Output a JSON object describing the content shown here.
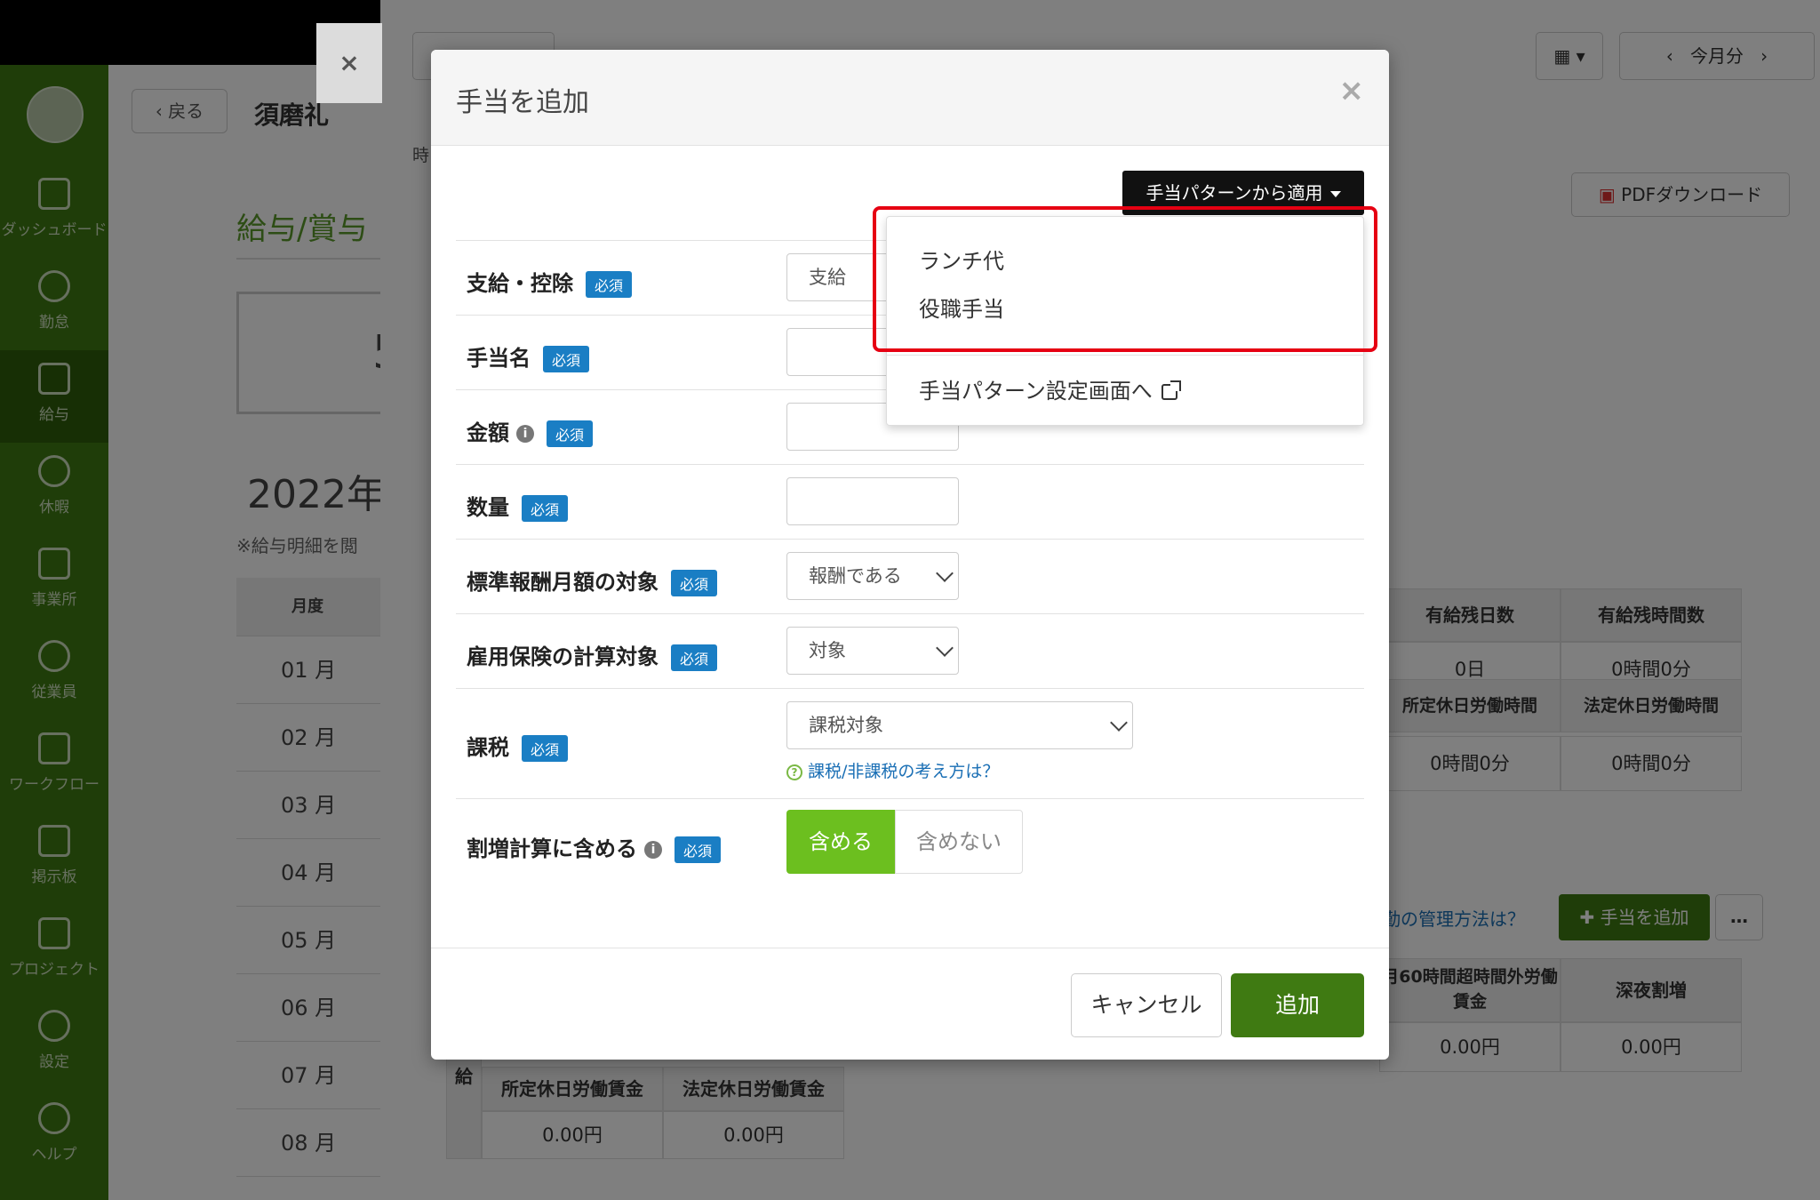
{
  "sidebar": {
    "items": [
      {
        "label": "ダッシュボード"
      },
      {
        "label": "勤怠"
      },
      {
        "label": "給与"
      },
      {
        "label": "休暇"
      },
      {
        "label": "事業所"
      },
      {
        "label": "従業員"
      },
      {
        "label": "ワークフロー"
      },
      {
        "label": "掲示板"
      },
      {
        "label": "プロジェクト"
      },
      {
        "label": "設定"
      },
      {
        "label": "ヘルプ"
      }
    ]
  },
  "background": {
    "back_label": "戻る",
    "employee_name": "須磨礼",
    "time_label": "時",
    "section_title": "給与/賞与",
    "big_number": "5",
    "year": "2022年",
    "note": "※給与明細を閲",
    "month_header": "月度",
    "months": [
      "01 月",
      "02 月",
      "03 月",
      "04 月",
      "05 月",
      "06 月",
      "07 月",
      "08 月"
    ],
    "this_month": "今月分",
    "pdf_download": "PDFダウンロード",
    "table_headers_1": [
      "有給残日数",
      "有給残時間数"
    ],
    "table_values_1": [
      "0日",
      "0時間0分"
    ],
    "table_headers_2": [
      "所定休日労働時間",
      "法定休日労働時間"
    ],
    "table_values_2": [
      "0時間0分",
      "0時間0分"
    ],
    "manage_link": "勤の管理方法は？",
    "add_allowance_btn": "手当を追加",
    "more_btn": "…",
    "table_headers_3": [
      "月60時間超時間外労働賃金",
      "深夜割増"
    ],
    "table_values_3": [
      "0.00円",
      "0.00円"
    ],
    "pay_label": "給",
    "table_headers_4": [
      "所定休日労働賃金",
      "法定休日労働賃金"
    ],
    "table_values_4": [
      "0.00円",
      "0.00円"
    ]
  },
  "modal": {
    "title": "手当を追加",
    "close": "×",
    "pattern_button": "手当パターンから適用",
    "required_badge": "必須",
    "fields": {
      "type": {
        "label": "支給・控除",
        "value": "支給"
      },
      "name": {
        "label": "手当名",
        "value": ""
      },
      "amount": {
        "label": "金額",
        "value": ""
      },
      "quantity": {
        "label": "数量",
        "value": ""
      },
      "standard_remuneration": {
        "label": "標準報酬月額の対象",
        "value": "報酬である"
      },
      "employment_insurance": {
        "label": "雇用保険の計算対象",
        "value": "対象"
      },
      "taxation": {
        "label": "課税",
        "value": "課税対象",
        "help": "課税/非課税の考え方は？"
      },
      "overtime": {
        "label": "割増計算に含める",
        "on": "含める",
        "off": "含めない"
      }
    },
    "cancel": "キャンセル",
    "submit": "追加"
  },
  "dropdown": {
    "items": [
      "ランチ代",
      "役職手当"
    ],
    "settings_link": "手当パターン設定画面へ"
  },
  "colors": {
    "brand_green": "#3f7a12",
    "toggle_green": "#6cbf1f",
    "badge_blue": "#1a7ec4",
    "highlight_red": "#e60012"
  }
}
